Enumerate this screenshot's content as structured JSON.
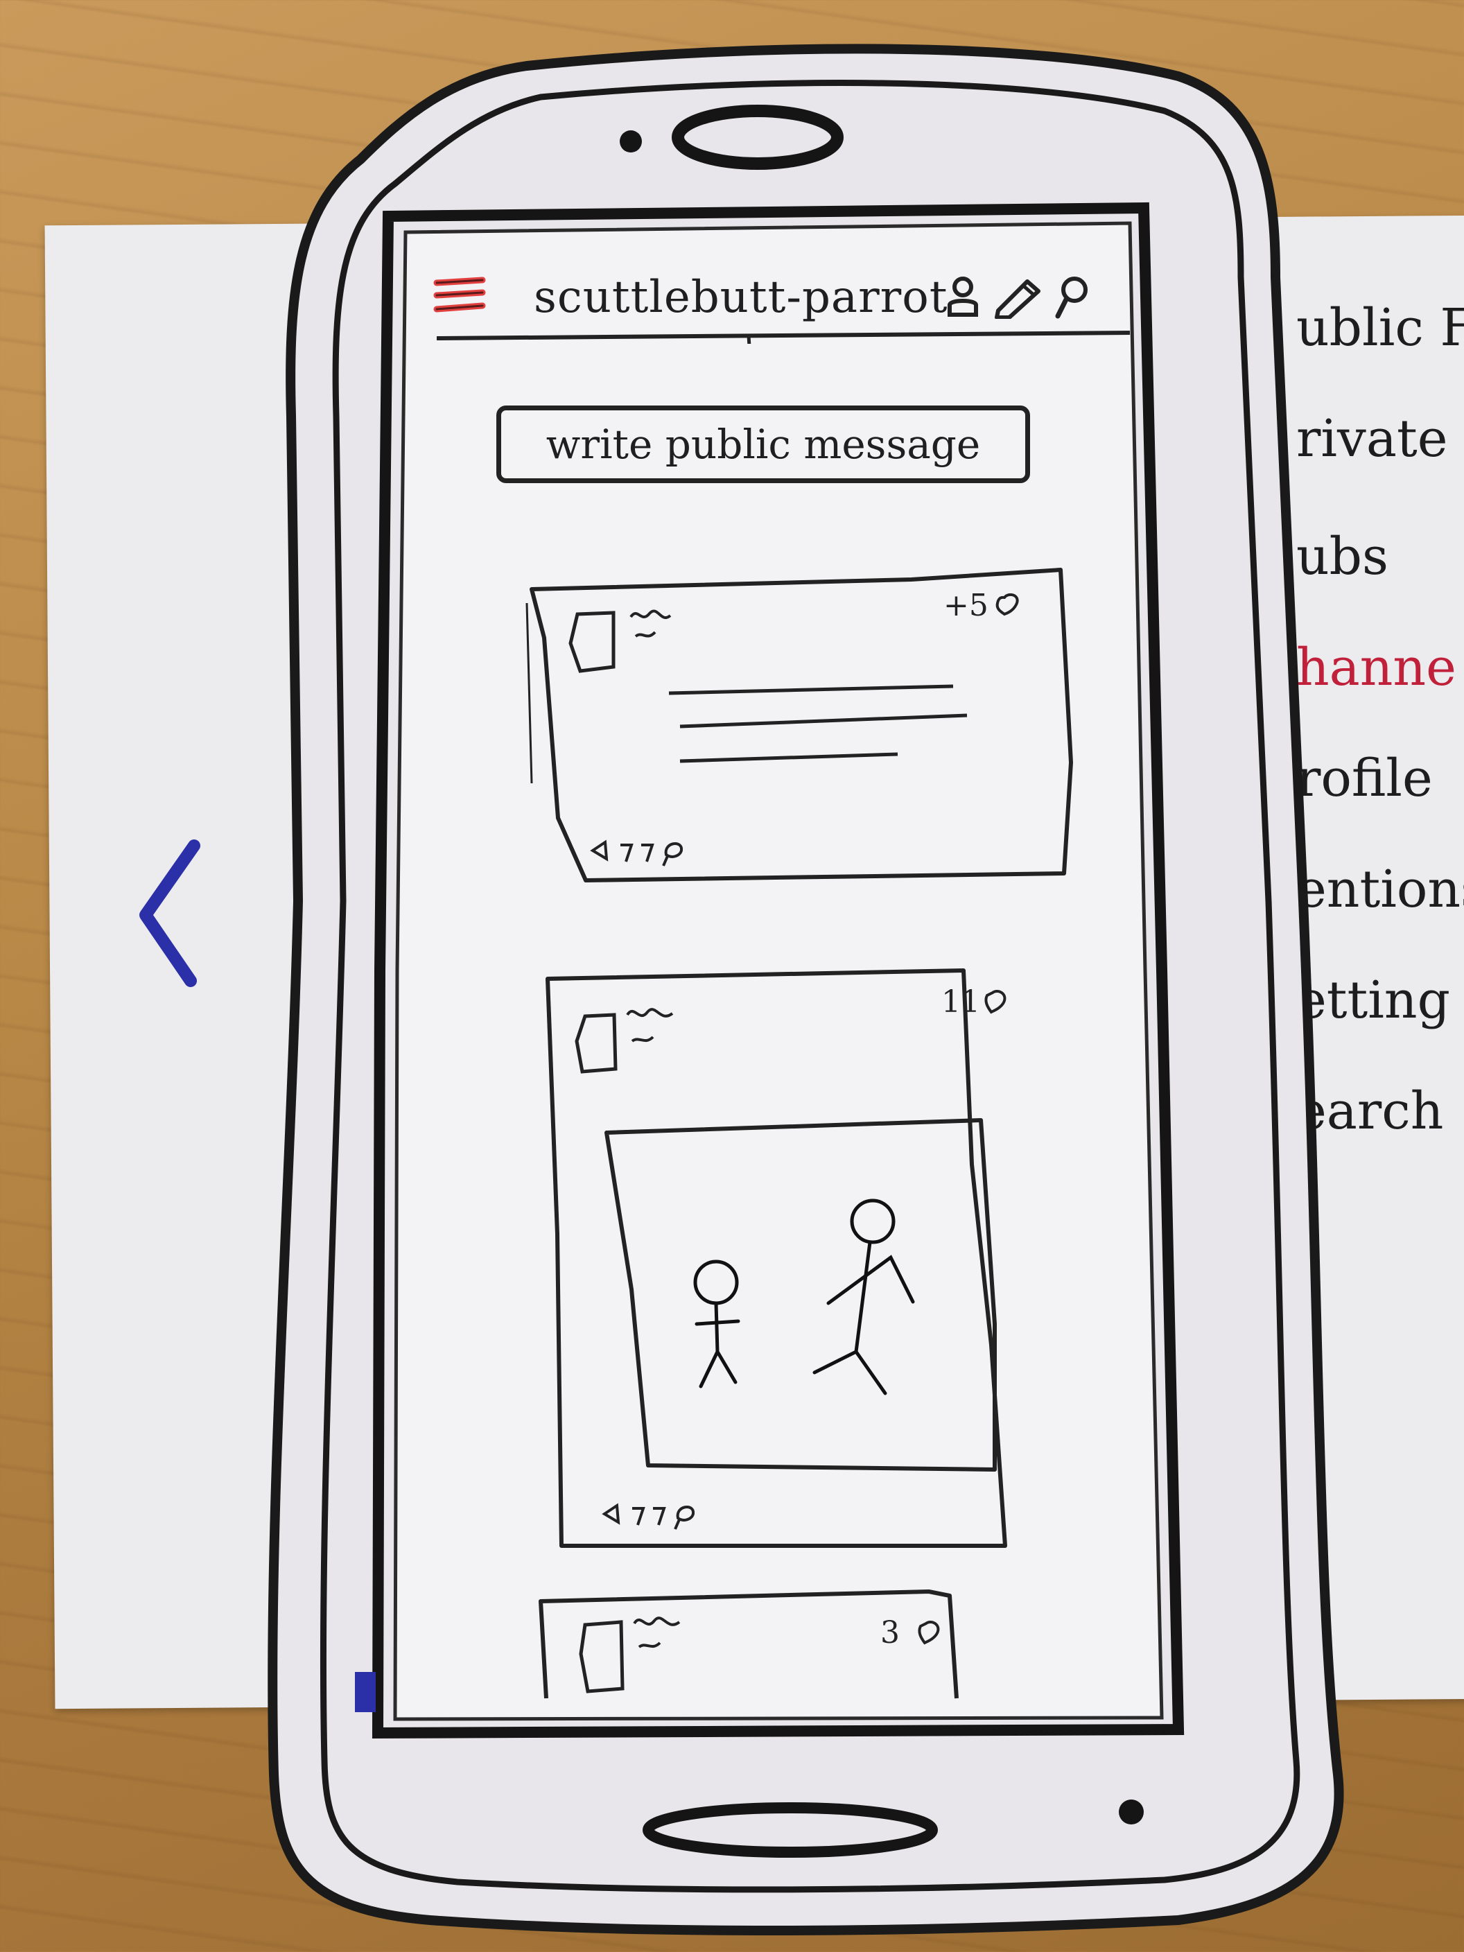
{
  "app": {
    "title": "scuttlebutt-parrot",
    "toolbar_icons": [
      "person-icon",
      "pen-icon",
      "search-icon"
    ],
    "menu_icon": "hamburger-icon",
    "accent_color": "#e2403f"
  },
  "compose": {
    "label": "write public message"
  },
  "posts": [
    {
      "type": "text",
      "likes_label": "+5",
      "actions": [
        "like-icon",
        "share-icon",
        "reply-icon",
        "comment-icon"
      ]
    },
    {
      "type": "image",
      "likes_label": "11",
      "actions": [
        "like-icon",
        "share-icon",
        "reply-icon",
        "comment-icon"
      ]
    },
    {
      "type": "text",
      "likes_label": "3"
    }
  ],
  "side_menu": {
    "items": [
      {
        "label": "ublic Fe",
        "active": false
      },
      {
        "label": "rivate F",
        "active": false
      },
      {
        "label": "ubs",
        "active": false
      },
      {
        "label": "hanne",
        "active": true
      },
      {
        "label": "rofile",
        "active": false
      },
      {
        "label": "entions",
        "active": false
      },
      {
        "label": "etting",
        "active": false
      },
      {
        "label": "earch",
        "active": false
      }
    ],
    "active_color": "#c0203a"
  },
  "back_arrow": {
    "color": "#2b2fa8"
  }
}
